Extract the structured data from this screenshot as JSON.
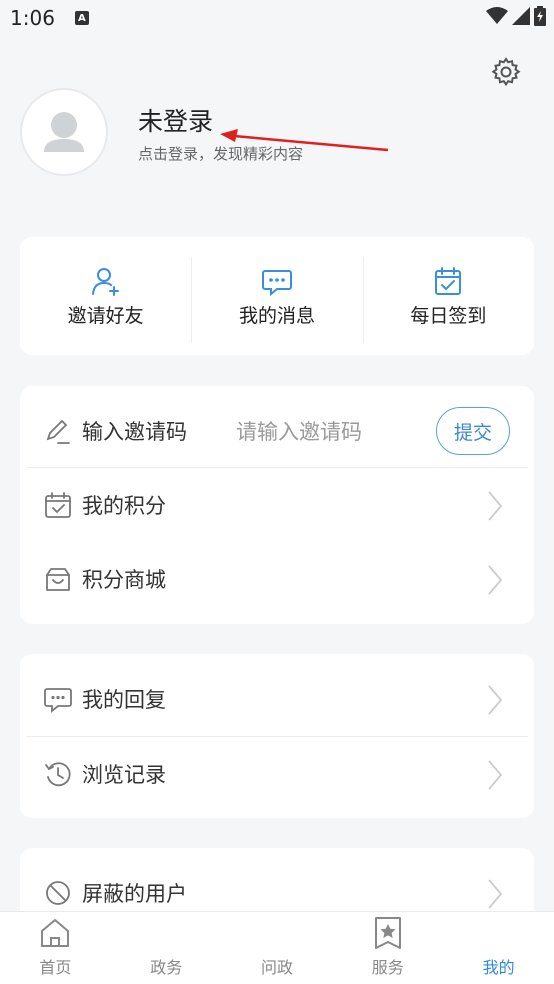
{
  "status_bar": {
    "time": "1:06",
    "notif_letter": "A"
  },
  "header": {
    "settings_icon": "gear-icon"
  },
  "profile": {
    "title": "未登录",
    "subtitle": "点击登录，发现精彩内容"
  },
  "quick_actions": [
    {
      "label": "邀请好友",
      "icon": "add-user-icon"
    },
    {
      "label": "我的消息",
      "icon": "message-icon"
    },
    {
      "label": "每日签到",
      "icon": "calendar-check-icon"
    }
  ],
  "invite": {
    "label": "输入邀请码",
    "placeholder": "请输入邀请码",
    "submit_label": "提交"
  },
  "menu1": [
    {
      "label": "我的积分",
      "icon": "points-calendar-icon"
    },
    {
      "label": "积分商城",
      "icon": "gift-box-icon"
    }
  ],
  "menu2": [
    {
      "label": "我的回复",
      "icon": "chat-bubble-icon"
    },
    {
      "label": "浏览记录",
      "icon": "history-icon"
    }
  ],
  "menu3": [
    {
      "label": "屏蔽的用户",
      "icon": "block-icon"
    }
  ],
  "tabbar": [
    {
      "label": "首页",
      "icon": "home-icon",
      "active": false
    },
    {
      "label": "政务",
      "icon": "",
      "active": false
    },
    {
      "label": "问政",
      "icon": "",
      "active": false
    },
    {
      "label": "服务",
      "icon": "star-bookmark-icon",
      "active": false
    },
    {
      "label": "我的",
      "icon": "",
      "active": true
    }
  ],
  "colors": {
    "accent": "#2f8ae0",
    "annotation_arrow": "#e02020"
  }
}
